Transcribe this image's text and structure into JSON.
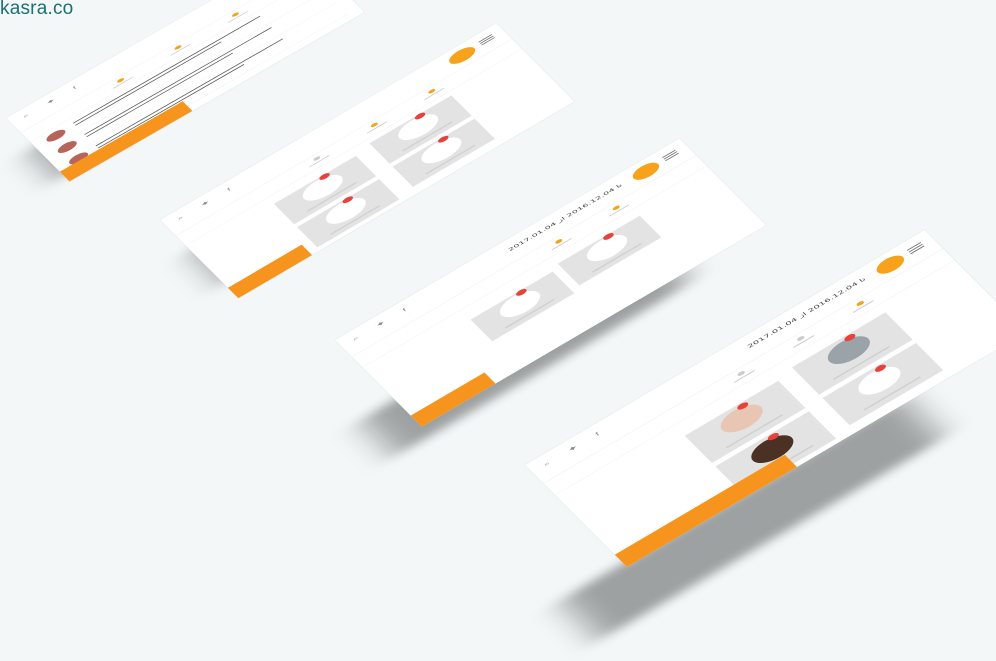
{
  "brand": {
    "text": "kasra.co"
  },
  "colors": {
    "accent": "#f7941d",
    "badge": "#e8413b",
    "tile": "#e3e3e3",
    "text_brand": "#1f6f73"
  },
  "screens": [
    {
      "id": "screen-1",
      "date_text": "",
      "footer_label": "",
      "items": [
        1,
        2,
        3,
        4
      ]
    },
    {
      "id": "screen-2",
      "date_text": "",
      "footer_label": "",
      "tiles": 4
    },
    {
      "id": "screen-3",
      "date_text": "2017.01.04 تا 2016.12.04 از",
      "footer_label": "",
      "tiles": 2
    },
    {
      "id": "screen-4",
      "date_text": "2017.01.04 تا 2016.12.04 از",
      "footer_label": "",
      "tiles": 4
    }
  ],
  "icons": {
    "menu": "hamburger-icon",
    "logo": "logo-icon",
    "search": "search-icon",
    "twitter": "twitter-icon",
    "facebook": "facebook-icon",
    "notification": "notification-dot-icon"
  }
}
